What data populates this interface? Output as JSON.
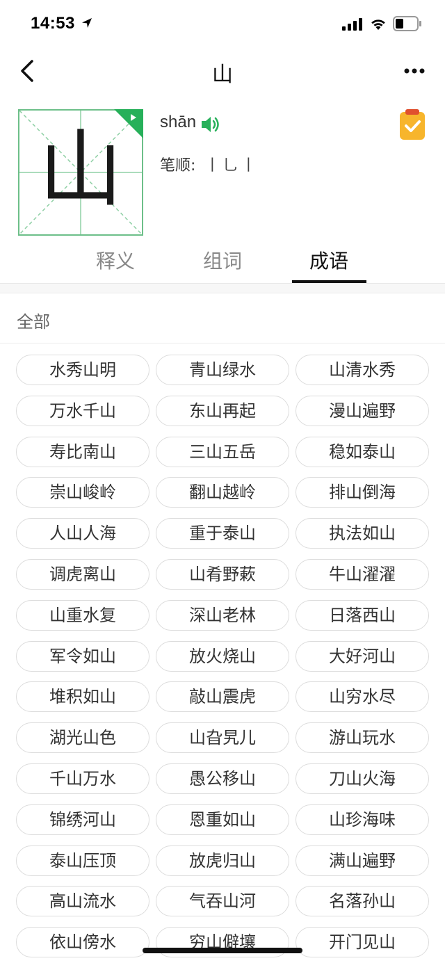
{
  "status_bar": {
    "time": "14:53"
  },
  "nav": {
    "title": "山"
  },
  "character": {
    "glyph": "山",
    "pinyin": "shān",
    "stroke_label": "笔顺:",
    "strokes": "丨乚丨"
  },
  "tabs": [
    {
      "label": "释义",
      "active": false
    },
    {
      "label": "组词",
      "active": false
    },
    {
      "label": "成语",
      "active": true
    }
  ],
  "filter": {
    "label": "全部"
  },
  "idioms": [
    "水秀山明",
    "青山绿水",
    "山清水秀",
    "万水千山",
    "东山再起",
    "漫山遍野",
    "寿比南山",
    "三山五岳",
    "稳如泰山",
    "崇山峻岭",
    "翻山越岭",
    "排山倒海",
    "人山人海",
    "重于泰山",
    "执法如山",
    "调虎离山",
    "山肴野蔌",
    "牛山濯濯",
    "山重水复",
    "深山老林",
    "日落西山",
    "军令如山",
    "放火烧山",
    "大好河山",
    "堆积如山",
    "敲山震虎",
    "山穷水尽",
    "湖光山色",
    "山旮旯儿",
    "游山玩水",
    "千山万水",
    "愚公移山",
    "刀山火海",
    "锦绣河山",
    "恩重如山",
    "山珍海味",
    "泰山压顶",
    "放虎归山",
    "满山遍野",
    "高山流水",
    "气吞山河",
    "名落孙山",
    "依山傍水",
    "穷山僻壤",
    "开门见山"
  ],
  "colors": {
    "accent_green": "#27b05a",
    "grid_green": "#6dbf89",
    "clipboard_orange": "#f7b52c",
    "active_tab": "#111111",
    "inactive_tab": "#888888"
  },
  "icons": {
    "location": "location-arrow-icon",
    "signal": "cellular-signal-icon",
    "wifi": "wifi-icon",
    "battery": "battery-icon",
    "back": "chevron-left-icon",
    "more": "more-dots-icon",
    "speaker": "speaker-icon",
    "play": "play-icon",
    "clipboard": "clipboard-check-icon"
  }
}
